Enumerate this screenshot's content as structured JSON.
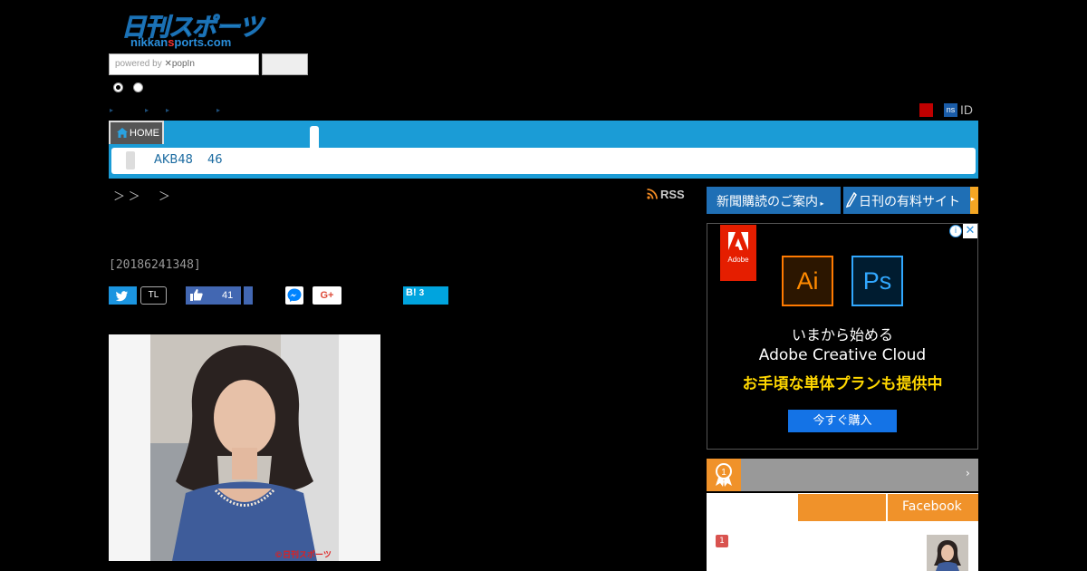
{
  "brand": {
    "logo_jp": "日刊スポーツ",
    "logo_en_pre": "nikkan",
    "logo_en_red": "s",
    "logo_en_post": "ports.com"
  },
  "search": {
    "placeholder_prefix": "powered by",
    "placeholder_brand": "popIn"
  },
  "account": {
    "ns_badge": "ns",
    "id_label": "ID"
  },
  "nav": {
    "home_label": "HOME",
    "sub_links": [
      "AKB48",
      "46"
    ]
  },
  "breadcrumb": "＞ ＞ 　 ＞",
  "rss_label": "RSS",
  "article": {
    "datetime": "[20186241348]",
    "photo_credit": "©日刊スポーツ"
  },
  "social": {
    "twitter_tl": "TL",
    "facebook_count": "41",
    "gplus_label": "G+",
    "hatena_label": "B!",
    "hatena_count": "3"
  },
  "sidebar": {
    "subscribe_label": "新聞購読のご案内",
    "paid_site_label": "日刊の有料サイト",
    "ad": {
      "brand": "Adobe",
      "ai": "Ai",
      "ps": "Ps",
      "line1": "いまから始める",
      "line2": "Adobe Creative Cloud",
      "line3": "お手頃な単体プランも提供中",
      "cta": "今すぐ購入",
      "info_icon": "i",
      "close_icon": "✕"
    },
    "ranking": {
      "badge_num": "1",
      "tab_facebook": "Facebook",
      "item_rank": "1"
    }
  },
  "colors": {
    "nav_blue": "#1b9cd6",
    "orange": "#f0922a",
    "link_blue": "#1f6fb5"
  }
}
